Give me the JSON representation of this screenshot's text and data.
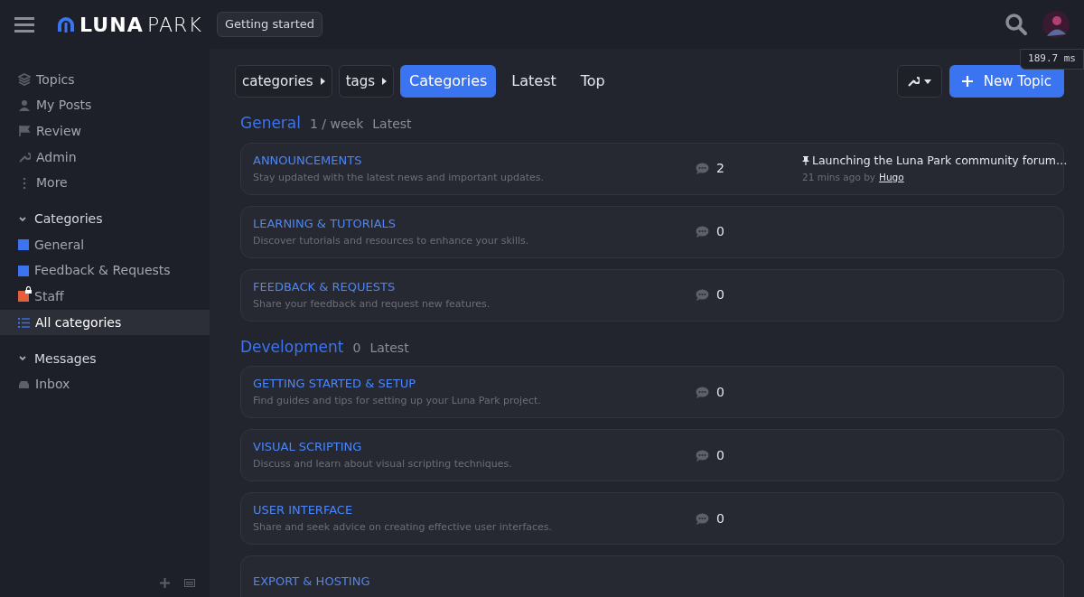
{
  "header": {
    "logo": {
      "bold": "LUNA",
      "light": "PARK"
    },
    "badge": "Getting started",
    "timing": "189.7 ms"
  },
  "sidebar": {
    "items": [
      {
        "label": "Topics"
      },
      {
        "label": "My Posts"
      },
      {
        "label": "Review"
      },
      {
        "label": "Admin"
      },
      {
        "label": "More"
      }
    ],
    "sections": [
      {
        "title": "Categories",
        "expanded": true,
        "items": [
          {
            "label": "General",
            "kind": "category",
            "color": "#3b74f0",
            "locked": false,
            "selected": false
          },
          {
            "label": "Feedback & Requests",
            "kind": "category",
            "color": "#3b74f0",
            "locked": false,
            "selected": false
          },
          {
            "label": "Staff",
            "kind": "category",
            "color": "#e4603c",
            "locked": true,
            "selected": false
          },
          {
            "label": "All categories",
            "kind": "list",
            "selected": true
          }
        ]
      },
      {
        "title": "Messages",
        "expanded": true,
        "items": [
          {
            "label": "Inbox",
            "kind": "inbox",
            "selected": false
          }
        ]
      }
    ]
  },
  "nav": {
    "dropdowns": [
      "categories",
      "tags"
    ],
    "tabs": [
      {
        "label": "Categories",
        "selected": true
      },
      {
        "label": "Latest",
        "selected": false
      },
      {
        "label": "Top",
        "selected": false
      }
    ],
    "new_topic": "New Topic"
  },
  "groups": [
    {
      "name": "General",
      "stats": "1 / week",
      "latest": "Latest",
      "categories": [
        {
          "name": "ANNOUNCEMENTS",
          "description": "Stay updated with the latest news and important updates.",
          "count": "2",
          "latest_topic": {
            "title": "Launching the Luna Park community forum…",
            "pinned": true,
            "age": "21 mins ago by",
            "author": "Hugo"
          }
        },
        {
          "name": "LEARNING & TUTORIALS",
          "description": "Discover tutorials and resources to enhance your skills.",
          "count": "0"
        },
        {
          "name": "FEEDBACK & REQUESTS",
          "description": "Share your feedback and request new features.",
          "count": "0"
        }
      ]
    },
    {
      "name": "Development",
      "stats": "0",
      "latest": "Latest",
      "categories": [
        {
          "name": "GETTING STARTED & SETUP",
          "description": "Find guides and tips for setting up your Luna Park project.",
          "count": "0"
        },
        {
          "name": "VISUAL SCRIPTING",
          "description": "Discuss and learn about visual scripting techniques.",
          "count": "0"
        },
        {
          "name": "USER INTERFACE",
          "description": "Share and seek advice on creating effective user interfaces.",
          "count": "0"
        },
        {
          "name": "EXPORT & HOSTING"
        }
      ]
    }
  ]
}
